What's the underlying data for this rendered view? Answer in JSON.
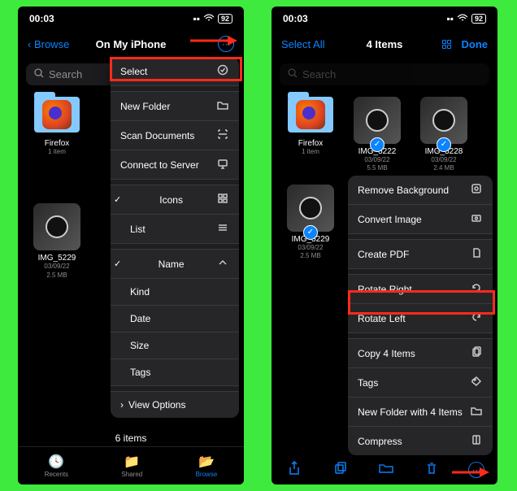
{
  "left": {
    "status": {
      "time": "00:03",
      "battery": "92"
    },
    "header": {
      "back": "Browse",
      "title": "On My iPhone"
    },
    "search_placeholder": "Search",
    "grid": [
      {
        "name": "Firefox",
        "meta1": "1 item",
        "meta2": ""
      },
      {
        "name": "IMG_5229",
        "meta1": "03/09/22",
        "meta2": "2.5 MB"
      }
    ],
    "menu": {
      "select": "Select",
      "new_folder": "New Folder",
      "scan_docs": "Scan Documents",
      "connect": "Connect to Server",
      "icons": "Icons",
      "list": "List",
      "name": "Name",
      "kind": "Kind",
      "date": "Date",
      "size": "Size",
      "tags": "Tags",
      "view_options": "View Options"
    },
    "count_line": "6 items",
    "tabs": {
      "recents": "Recents",
      "shared": "Shared",
      "browse": "Browse"
    }
  },
  "right": {
    "status": {
      "time": "00:03",
      "battery": "92"
    },
    "header": {
      "selectall": "Select All",
      "title": "4 Items",
      "done": "Done"
    },
    "search_placeholder": "Search",
    "grid": [
      {
        "name": "Firefox",
        "meta1": "1 item",
        "meta2": "",
        "checked": false,
        "kind": "folder-firefox"
      },
      {
        "name": "IMG_5222",
        "meta1": "03/09/22",
        "meta2": "5.5 MB",
        "checked": true,
        "kind": "watch"
      },
      {
        "name": "IMG_5228",
        "meta1": "03/09/22",
        "meta2": "2.4 MB",
        "checked": true,
        "kind": "watch"
      },
      {
        "name": "IMG_5229",
        "meta1": "03/09/22",
        "meta2": "2.5 MB",
        "checked": true,
        "kind": "watch"
      },
      {
        "name": "",
        "meta1": "",
        "meta2": "",
        "checked": true,
        "kind": "watch-partial"
      },
      {
        "name": "",
        "meta1": "",
        "meta2": "",
        "checked": false,
        "kind": "folder-scan"
      }
    ],
    "ctx": {
      "remove_bg": "Remove Background",
      "convert": "Convert Image",
      "create_pdf": "Create PDF",
      "rot_right": "Rotate Right",
      "rot_left": "Rotate Left",
      "copy": "Copy 4 Items",
      "tags": "Tags",
      "new_folder": "New Folder with 4 Items",
      "compress": "Compress"
    }
  }
}
